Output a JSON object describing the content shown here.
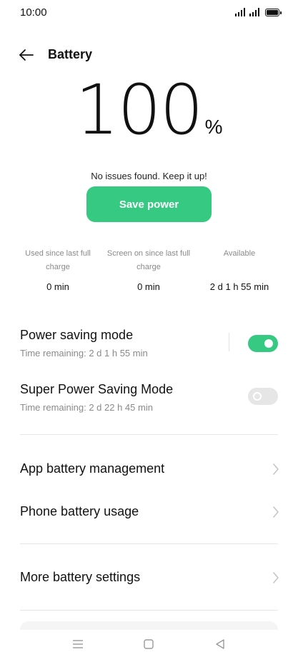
{
  "status_bar": {
    "time": "10:00",
    "icons": [
      "signal-icon",
      "signal-icon",
      "battery-icon"
    ]
  },
  "header": {
    "title": "Battery",
    "back_icon": "arrow-left-icon"
  },
  "battery": {
    "percent": "100",
    "percent_sign": "%",
    "message": "No issues found. Keep it up!",
    "save_button": "Save power"
  },
  "stats": [
    {
      "label": "Used since last full charge",
      "value": "0 min"
    },
    {
      "label": "Screen on since last full charge",
      "value": "0 min"
    },
    {
      "label": "Available",
      "value": "2 d 1 h 55 min"
    }
  ],
  "modes": [
    {
      "title": "Power saving mode",
      "subtitle": "Time remaining:  2 d 1 h 55 min",
      "enabled": true
    },
    {
      "title": "Super Power Saving Mode",
      "subtitle": "Time remaining:  2 d 22 h 45 min",
      "enabled": false
    }
  ],
  "menu": [
    {
      "label": "App battery management",
      "icon": "chevron-right-icon"
    },
    {
      "label": "Phone battery usage",
      "icon": "chevron-right-icon"
    },
    {
      "label": "More battery settings",
      "icon": "chevron-right-icon"
    }
  ],
  "nav_bar": {
    "icons": [
      "menu-icon",
      "home-icon",
      "back-triangle-icon"
    ]
  },
  "colors": {
    "accent": "#36c982",
    "text_primary": "#111111",
    "text_secondary": "#8a8a8a",
    "divider": "#e6e6e6",
    "toggle_off": "#e6e6e6"
  }
}
